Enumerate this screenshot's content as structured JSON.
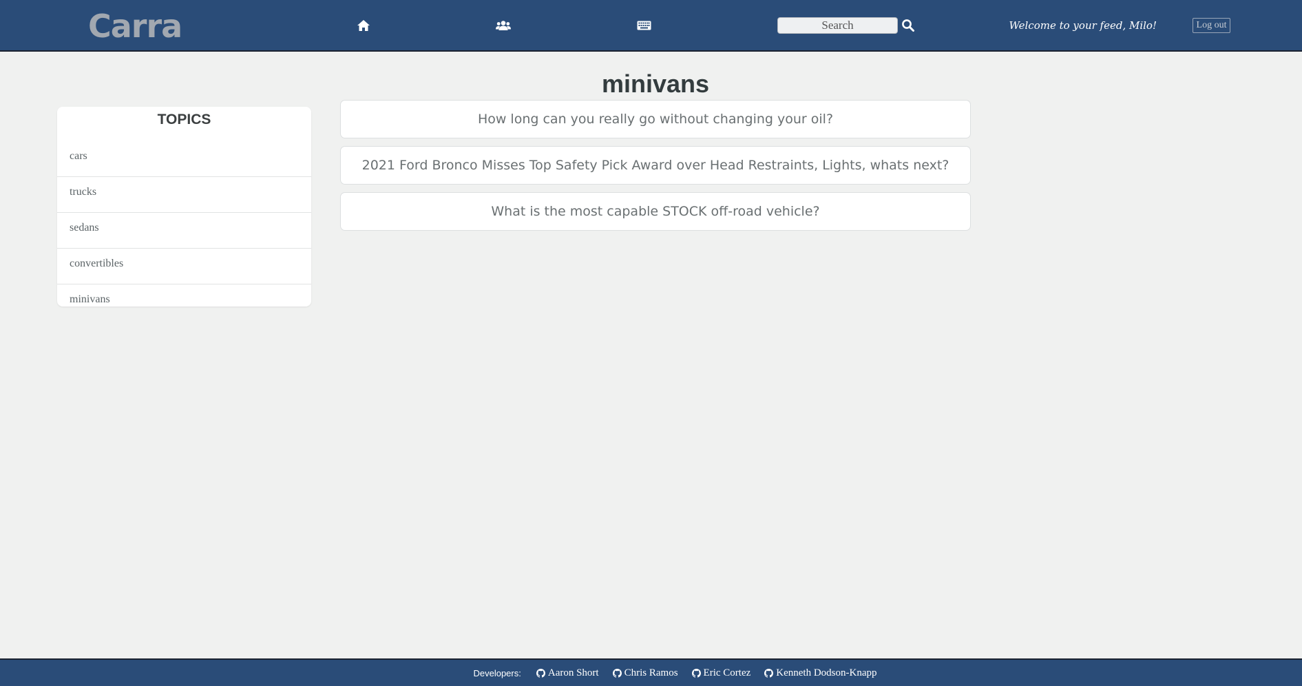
{
  "header": {
    "logo": "Carra",
    "nav": [
      {
        "icon": "home-icon"
      },
      {
        "icon": "users-icon"
      },
      {
        "icon": "keyboard-icon"
      }
    ],
    "search_placeholder": "Search",
    "welcome": "Welcome to your feed, Milo!",
    "logout_label": "Log out"
  },
  "topic": {
    "title": "minivans"
  },
  "sidebar": {
    "title": "TOPICS",
    "items": [
      {
        "label": "cars"
      },
      {
        "label": "trucks"
      },
      {
        "label": "sedans"
      },
      {
        "label": "convertibles"
      },
      {
        "label": "minivans"
      }
    ]
  },
  "posts": [
    {
      "title": "How long can you really go without changing your oil?"
    },
    {
      "title": "2021 Ford Bronco Misses Top Safety Pick Award over Head Restraints, Lights, whats next?"
    },
    {
      "title": "What is the most capable STOCK off-road vehicle?"
    }
  ],
  "footer": {
    "label": "Developers:",
    "developers": [
      {
        "name": "Aaron Short",
        "icon": "github-icon"
      },
      {
        "name": "Chris Ramos",
        "icon": "github-icon"
      },
      {
        "name": "Eric Cortez",
        "icon": "github-icon"
      },
      {
        "name": "Kenneth Dodson-Knapp",
        "icon": "github-icon"
      }
    ]
  },
  "colors": {
    "header_bg": "#2a4c78",
    "page_bg": "#f0f1f0",
    "card_bg": "#ffffff"
  }
}
